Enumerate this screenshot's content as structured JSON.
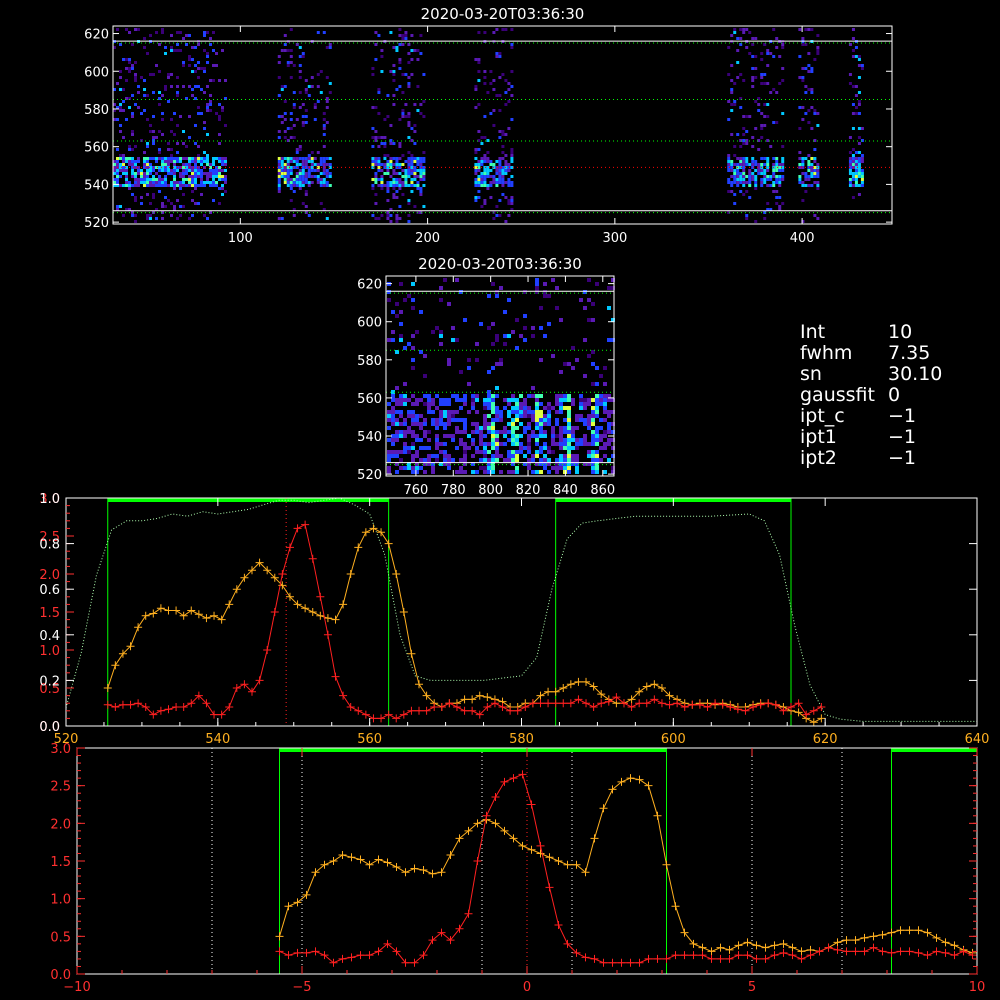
{
  "chart_data": [
    {
      "type": "heatmap",
      "title": "2020-03-20T03:36:30",
      "xlim": [
        32,
        448
      ],
      "ylim": [
        519,
        624
      ],
      "xticks": [
        "100",
        "200",
        "300",
        "400"
      ],
      "yticks": [
        "520",
        "540",
        "560",
        "580",
        "600",
        "620"
      ],
      "reference_lines": [
        {
          "y": 616,
          "style": "solid",
          "color": "#ffffff"
        },
        {
          "y": 615,
          "style": "dotted",
          "color": "#00ff00"
        },
        {
          "y": 585,
          "style": "dotted",
          "color": "#00ff00"
        },
        {
          "y": 563,
          "style": "dotted",
          "color": "#00ff00"
        },
        {
          "y": 549,
          "style": "dotted",
          "color": "#ff0000"
        },
        {
          "y": 526,
          "style": "solid",
          "color": "#ffffff"
        },
        {
          "y": 525,
          "style": "dotted",
          "color": "#00ff00"
        }
      ],
      "bands_x": [
        [
          32,
          92
        ],
        [
          120,
          148
        ],
        [
          170,
          198
        ],
        [
          225,
          245
        ],
        [
          360,
          390
        ],
        [
          398,
          408
        ],
        [
          425,
          432
        ]
      ],
      "colormap": [
        "#3a0078",
        "#5a1ab4",
        "#2040ff",
        "#00c8ff",
        "#40ffb0",
        "#e0ff40"
      ]
    },
    {
      "type": "heatmap",
      "title": "2020-03-20T03:36:30",
      "xlim": [
        744,
        866
      ],
      "ylim": [
        519,
        624
      ],
      "xticks": [
        "760",
        "780",
        "800",
        "820",
        "840",
        "860"
      ],
      "yticks": [
        "520",
        "540",
        "560",
        "580",
        "600",
        "620"
      ],
      "reference_lines": [
        {
          "y": 616,
          "style": "solid",
          "color": "#ffffff"
        },
        {
          "y": 615,
          "style": "dotted",
          "color": "#00ff00"
        },
        {
          "y": 585,
          "style": "dotted",
          "color": "#00ff00"
        },
        {
          "y": 563,
          "style": "dotted",
          "color": "#00ff00"
        },
        {
          "y": 526,
          "style": "solid",
          "color": "#ffffff"
        },
        {
          "y": 525,
          "style": "dotted",
          "color": "#00ff00"
        }
      ],
      "colormap": [
        "#3a0078",
        "#5a1ab4",
        "#2040ff",
        "#00c8ff",
        "#40ffb0",
        "#e0ff40"
      ]
    },
    {
      "type": "line",
      "xlim": [
        520,
        640
      ],
      "ylim_left": [
        0,
        3.0
      ],
      "ylim_right": [
        0,
        1.0
      ],
      "xticks": [
        "520",
        "540",
        "560",
        "580",
        "600",
        "620",
        "640"
      ],
      "yticks_red": [
        "0.0",
        "0.5",
        "1.0",
        "1.5",
        "2.0",
        "2.5",
        "3.0"
      ],
      "yticks_white": [
        "0.0",
        "0.2",
        "0.4",
        "0.6",
        "0.8",
        "1.0"
      ],
      "center_line_x": 549,
      "passband_segments": [
        [
          525.5,
          562.5
        ],
        [
          584.5,
          615.5
        ]
      ],
      "transmission": {
        "color": "#b0ffb0",
        "x": [
          520,
          522,
          524,
          526,
          528,
          530,
          532,
          534,
          536,
          538,
          540,
          542,
          544,
          546,
          548,
          550,
          552,
          554,
          556,
          558,
          560,
          562,
          564,
          566,
          568,
          570,
          575,
          580,
          582,
          584,
          586,
          588,
          590,
          595,
          600,
          605,
          610,
          612,
          614,
          616,
          618,
          620,
          622,
          625,
          630,
          635,
          640
        ],
        "y": [
          0.08,
          0.32,
          0.66,
          0.86,
          0.9,
          0.9,
          0.91,
          0.93,
          0.92,
          0.94,
          0.93,
          0.94,
          0.95,
          0.97,
          0.99,
          0.99,
          0.98,
          0.99,
          1.0,
          0.97,
          0.93,
          0.75,
          0.4,
          0.22,
          0.2,
          0.2,
          0.2,
          0.22,
          0.3,
          0.6,
          0.82,
          0.89,
          0.9,
          0.92,
          0.92,
          0.92,
          0.93,
          0.9,
          0.75,
          0.44,
          0.18,
          0.05,
          0.03,
          0.02,
          0.02,
          0.02,
          0.02
        ]
      },
      "series": [
        {
          "color": "#ffb020",
          "x": [
            525.5,
            526.5,
            527.5,
            528.5,
            529.5,
            530.5,
            531.5,
            532.5,
            533.5,
            534.5,
            535.5,
            536.5,
            537.5,
            538.5,
            539.5,
            540.5,
            541.5,
            542.5,
            543.5,
            544.5,
            545.5,
            546.5,
            547.5,
            548.5,
            549.5,
            550.5,
            551.5,
            552.5,
            553.5,
            554.5,
            555.5,
            556.5,
            557.5,
            558.5,
            559.5,
            560.5,
            561.5,
            562.5,
            563.5,
            564.5,
            565.5,
            566.5,
            567.5,
            568.5,
            569.5,
            570.5,
            571.5,
            572.5,
            573.5,
            574.5,
            575.5,
            576.5,
            577.5,
            578.5,
            579.5,
            580.5,
            581.5,
            582.5,
            583.5,
            584.5,
            585.5,
            586.5,
            587.5,
            588.5,
            589.5,
            590.5,
            591.5,
            592.5,
            593.5,
            594.5,
            595.5,
            596.5,
            597.5,
            598.5,
            599.5,
            600.5,
            601.5,
            602.5,
            603.5,
            604.5,
            605.5,
            606.5,
            607.5,
            608.5,
            609.5,
            610.5,
            611.5,
            612.5,
            613.5,
            614.5,
            615.5,
            616.5,
            617.5,
            618.5,
            619.5
          ],
          "y": [
            0.5,
            0.8,
            0.95,
            1.05,
            1.3,
            1.45,
            1.48,
            1.55,
            1.52,
            1.52,
            1.45,
            1.52,
            1.47,
            1.42,
            1.45,
            1.4,
            1.6,
            1.8,
            1.95,
            2.05,
            2.15,
            2.05,
            1.95,
            1.85,
            1.7,
            1.6,
            1.55,
            1.5,
            1.45,
            1.42,
            1.4,
            1.6,
            2.0,
            2.35,
            2.55,
            2.6,
            2.55,
            2.4,
            2.0,
            1.5,
            0.95,
            0.55,
            0.4,
            0.3,
            0.25,
            0.3,
            0.3,
            0.35,
            0.35,
            0.4,
            0.38,
            0.35,
            0.32,
            0.25,
            0.25,
            0.3,
            0.3,
            0.4,
            0.45,
            0.45,
            0.5,
            0.55,
            0.58,
            0.58,
            0.52,
            0.42,
            0.35,
            0.3,
            0.3,
            0.35,
            0.45,
            0.52,
            0.55,
            0.5,
            0.4,
            0.35,
            0.3,
            0.28,
            0.3,
            0.3,
            0.28,
            0.3,
            0.28,
            0.25,
            0.25,
            0.28,
            0.3,
            0.3,
            0.28,
            0.25,
            0.2,
            0.18,
            0.1,
            0.05,
            0.1
          ]
        },
        {
          "color": "#ff2020",
          "x": [
            525.5,
            526.5,
            527.5,
            528.5,
            529.5,
            530.5,
            531.5,
            532.5,
            533.5,
            534.5,
            535.5,
            536.5,
            537.5,
            538.5,
            539.5,
            540.5,
            541.5,
            542.5,
            543.5,
            544.5,
            545.5,
            546.5,
            547.5,
            548.5,
            549.5,
            550.5,
            551.5,
            552.5,
            553.5,
            554.5,
            555.5,
            556.5,
            557.5,
            558.5,
            559.5,
            560.5,
            561.5,
            562.5,
            563.5,
            564.5,
            565.5,
            566.5,
            567.5,
            568.5,
            569.5,
            570.5,
            571.5,
            572.5,
            573.5,
            574.5,
            575.5,
            576.5,
            577.5,
            578.5,
            579.5,
            580.5,
            581.5,
            582.5,
            583.5,
            584.5,
            585.5,
            586.5,
            587.5,
            588.5,
            589.5,
            590.5,
            591.5,
            592.5,
            593.5,
            594.5,
            595.5,
            596.5,
            597.5,
            598.5,
            599.5,
            600.5,
            601.5,
            602.5,
            603.5,
            604.5,
            605.5,
            606.5,
            607.5,
            608.5,
            609.5,
            610.5,
            611.5,
            612.5,
            613.5,
            614.5,
            615.5,
            616.5,
            617.5,
            618.5,
            619.5
          ],
          "y": [
            0.28,
            0.25,
            0.28,
            0.28,
            0.3,
            0.25,
            0.15,
            0.2,
            0.22,
            0.25,
            0.25,
            0.3,
            0.4,
            0.3,
            0.15,
            0.15,
            0.25,
            0.5,
            0.55,
            0.45,
            0.6,
            1.0,
            1.5,
            2.0,
            2.35,
            2.6,
            2.65,
            2.2,
            1.7,
            1.2,
            0.65,
            0.4,
            0.25,
            0.2,
            0.15,
            0.1,
            0.1,
            0.15,
            0.1,
            0.15,
            0.2,
            0.2,
            0.2,
            0.25,
            0.25,
            0.3,
            0.25,
            0.2,
            0.2,
            0.15,
            0.25,
            0.3,
            0.25,
            0.2,
            0.2,
            0.25,
            0.3,
            0.3,
            0.3,
            0.3,
            0.3,
            0.3,
            0.35,
            0.3,
            0.25,
            0.3,
            0.32,
            0.38,
            0.3,
            0.25,
            0.3,
            0.3,
            0.35,
            0.3,
            0.28,
            0.3,
            0.25,
            0.28,
            0.28,
            0.25,
            0.3,
            0.28,
            0.25,
            0.22,
            0.2,
            0.25,
            0.28,
            0.3,
            0.28,
            0.2,
            0.25,
            0.3,
            0.15,
            0.2,
            0.25
          ]
        }
      ]
    },
    {
      "type": "line",
      "xlim": [
        -10,
        10
      ],
      "ylim": [
        0,
        3.0
      ],
      "xticks": [
        "−10",
        "−5",
        "0",
        "5",
        "10"
      ],
      "yticks": [
        "0.0",
        "0.5",
        "1.0",
        "1.5",
        "2.0",
        "2.5",
        "3.0"
      ],
      "center_line_x": 0,
      "dotted_lines_x": [
        -7,
        -5,
        -1,
        1,
        5,
        7
      ],
      "passband_segments": [
        [
          -5.5,
          3.1
        ],
        [
          8.1,
          10
        ]
      ],
      "series": [
        {
          "color": "#ffb020",
          "x": [
            -5.5,
            -5.3,
            -5.1,
            -4.9,
            -4.7,
            -4.5,
            -4.3,
            -4.1,
            -3.9,
            -3.7,
            -3.5,
            -3.3,
            -3.1,
            -2.9,
            -2.7,
            -2.5,
            -2.3,
            -2.1,
            -1.9,
            -1.7,
            -1.5,
            -1.3,
            -1.1,
            -0.9,
            -0.7,
            -0.5,
            -0.3,
            -0.1,
            0.1,
            0.3,
            0.5,
            0.7,
            0.9,
            1.1,
            1.3,
            1.5,
            1.7,
            1.9,
            2.1,
            2.3,
            2.5,
            2.7,
            2.9,
            3.1,
            3.3,
            3.5,
            3.7,
            3.9,
            4.1,
            4.3,
            4.5,
            4.7,
            4.9,
            5.1,
            5.3,
            5.5,
            5.7,
            5.9,
            6.1,
            6.3,
            6.5,
            6.7,
            6.9,
            7.1,
            7.3,
            7.5,
            7.7,
            7.9,
            8.1,
            8.3,
            8.5,
            8.7,
            8.9,
            9.1,
            9.3,
            9.5,
            9.7,
            9.9
          ],
          "y": [
            0.5,
            0.9,
            0.95,
            1.05,
            1.35,
            1.45,
            1.5,
            1.58,
            1.55,
            1.52,
            1.45,
            1.52,
            1.48,
            1.42,
            1.35,
            1.4,
            1.38,
            1.33,
            1.35,
            1.58,
            1.8,
            1.9,
            2.0,
            2.05,
            2.0,
            1.9,
            1.8,
            1.7,
            1.65,
            1.6,
            1.55,
            1.5,
            1.45,
            1.45,
            1.35,
            1.8,
            2.2,
            2.45,
            2.55,
            2.6,
            2.58,
            2.5,
            2.1,
            1.45,
            0.9,
            0.55,
            0.4,
            0.35,
            0.3,
            0.35,
            0.32,
            0.38,
            0.42,
            0.38,
            0.35,
            0.38,
            0.4,
            0.35,
            0.3,
            0.32,
            0.3,
            0.35,
            0.42,
            0.45,
            0.45,
            0.48,
            0.5,
            0.52,
            0.55,
            0.58,
            0.58,
            0.58,
            0.55,
            0.48,
            0.42,
            0.38,
            0.32,
            0.28
          ]
        },
        {
          "color": "#ff2020",
          "x": [
            -5.5,
            -5.3,
            -5.1,
            -4.9,
            -4.7,
            -4.5,
            -4.3,
            -4.1,
            -3.9,
            -3.7,
            -3.5,
            -3.3,
            -3.1,
            -2.9,
            -2.7,
            -2.5,
            -2.3,
            -2.1,
            -1.9,
            -1.7,
            -1.5,
            -1.3,
            -1.1,
            -0.9,
            -0.7,
            -0.5,
            -0.3,
            -0.1,
            0.1,
            0.3,
            0.5,
            0.7,
            0.9,
            1.1,
            1.3,
            1.5,
            1.7,
            1.9,
            2.1,
            2.3,
            2.5,
            2.7,
            2.9,
            3.1,
            3.3,
            3.5,
            3.7,
            3.9,
            4.1,
            4.3,
            4.5,
            4.7,
            4.9,
            5.1,
            5.3,
            5.5,
            5.7,
            5.9,
            6.1,
            6.3,
            6.5,
            6.7,
            6.9,
            7.1,
            7.3,
            7.5,
            7.7,
            7.9,
            8.1,
            8.3,
            8.5,
            8.7,
            8.9,
            9.1,
            9.3,
            9.5,
            9.7,
            9.9
          ],
          "y": [
            0.3,
            0.25,
            0.28,
            0.28,
            0.3,
            0.25,
            0.15,
            0.2,
            0.22,
            0.25,
            0.25,
            0.3,
            0.4,
            0.3,
            0.15,
            0.15,
            0.25,
            0.45,
            0.55,
            0.45,
            0.6,
            0.8,
            1.5,
            2.1,
            2.35,
            2.55,
            2.6,
            2.65,
            2.25,
            1.7,
            1.15,
            0.65,
            0.4,
            0.28,
            0.22,
            0.2,
            0.15,
            0.15,
            0.15,
            0.15,
            0.15,
            0.2,
            0.2,
            0.2,
            0.25,
            0.25,
            0.25,
            0.25,
            0.2,
            0.2,
            0.2,
            0.25,
            0.25,
            0.2,
            0.2,
            0.25,
            0.28,
            0.25,
            0.2,
            0.25,
            0.3,
            0.35,
            0.32,
            0.3,
            0.3,
            0.3,
            0.35,
            0.3,
            0.28,
            0.3,
            0.3,
            0.28,
            0.25,
            0.3,
            0.28,
            0.25,
            0.3,
            0.25
          ]
        }
      ]
    }
  ],
  "info_panel": [
    {
      "key": "Int",
      "value": "10"
    },
    {
      "key": "fwhm",
      "value": "7.35"
    },
    {
      "key": "sn",
      "value": "30.10"
    },
    {
      "key": "gaussfit",
      "value": "0"
    },
    {
      "key": "ipt_c",
      "value": "−1"
    },
    {
      "key": "ipt1",
      "value": "−1"
    },
    {
      "key": "ipt2",
      "value": "−1"
    }
  ]
}
